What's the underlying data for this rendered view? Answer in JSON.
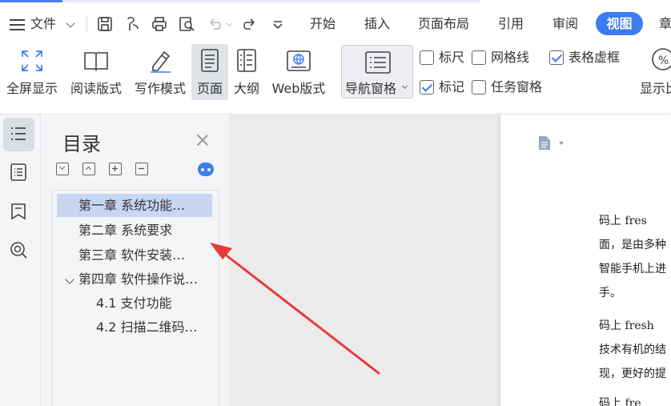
{
  "ribbon": {
    "file_menu": "文件",
    "tabs": [
      "开始",
      "插入",
      "页面布局",
      "引用",
      "审阅",
      "视图",
      "章"
    ],
    "active_tab": "视图",
    "tools": {
      "fullscreen": "全屏显示",
      "read_mode": "阅读版式",
      "write_mode": "写作模式",
      "page": "页面",
      "outline": "大纲",
      "web": "Web版式",
      "nav_pane": "导航窗格",
      "display_ratio": "显示比"
    },
    "checkboxes": {
      "ruler": "标尺",
      "gridlines": "网格线",
      "table_gridlines": "表格虚框",
      "marks": "标记",
      "task_pane": "任务窗格"
    },
    "checked": {
      "ruler": false,
      "gridlines": false,
      "table_gridlines": true,
      "marks": true,
      "task_pane": false
    }
  },
  "nav_pane": {
    "title": "目录",
    "toc": [
      {
        "text": "第一章   系统功能…",
        "selected": true
      },
      {
        "text": "第二章   系统要求",
        "selected": false
      },
      {
        "text": "第三章   软件安装…",
        "selected": false
      },
      {
        "text": "第四章  软件操作说…",
        "selected": false
      },
      {
        "text": "4.1  支付功能",
        "selected": false
      },
      {
        "text": "4.2   扫描二维码…",
        "selected": false
      }
    ]
  },
  "document": {
    "lines": [
      "    码上 fres",
      "面，是由多种",
      "智能手机上进",
      "手。",
      "   码上 fresh",
      "技术有机的结",
      "现，更好的提",
      "   码上 fre"
    ]
  },
  "colors": {
    "accent": "#3d7cf0",
    "arrow": "#e8393a",
    "selection": "#c8d6f3"
  }
}
